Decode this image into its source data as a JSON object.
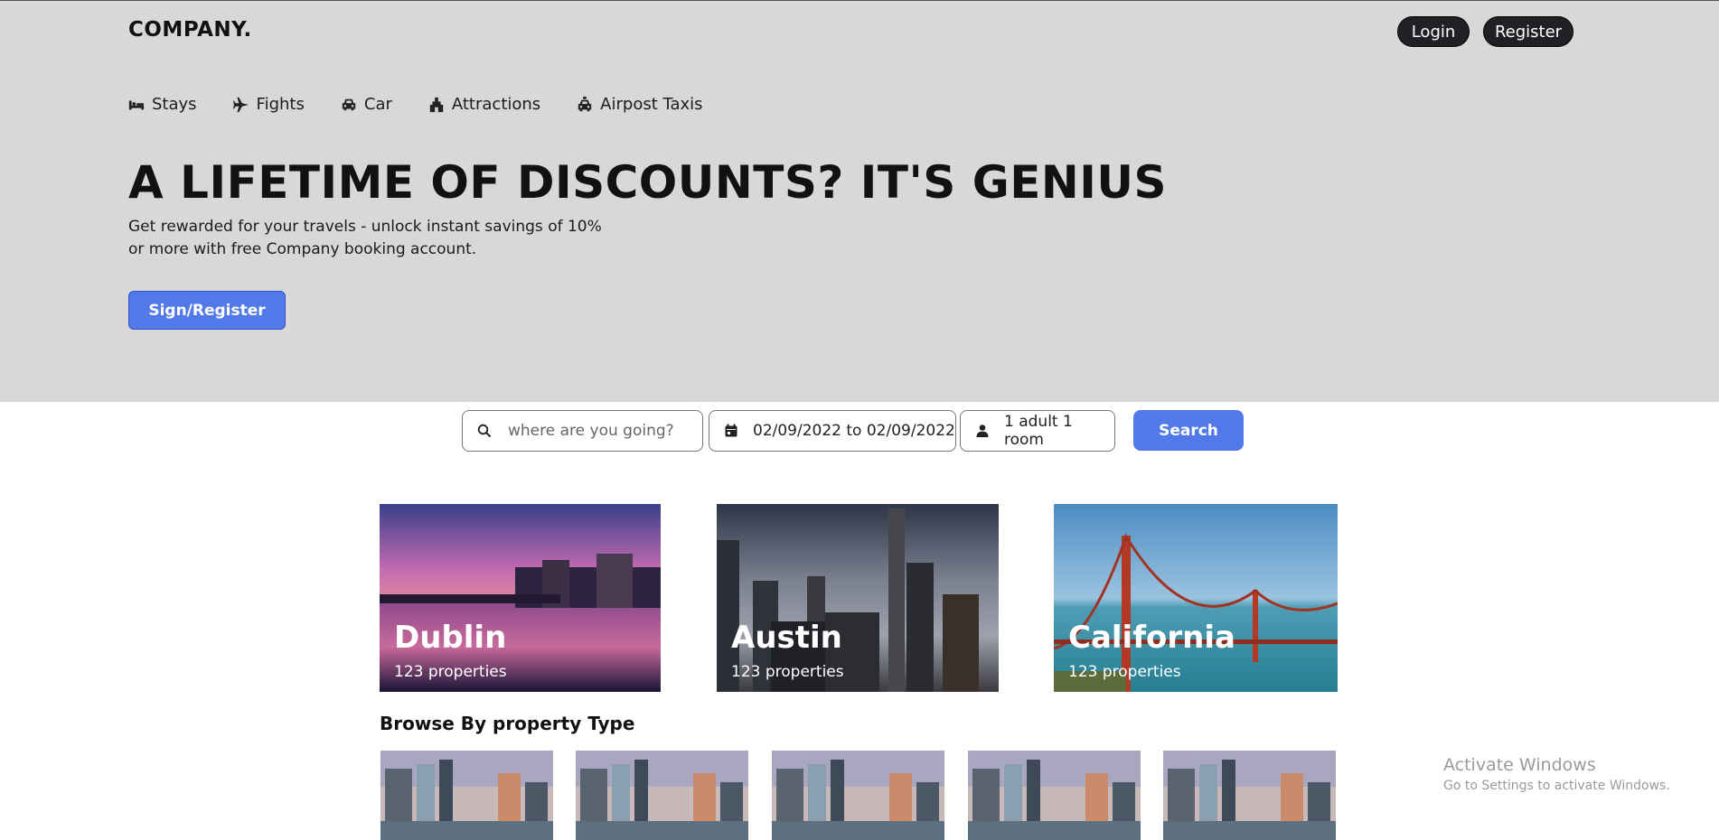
{
  "brand": "COMPANY.",
  "auth": {
    "login_label": "Login",
    "register_label": "Register"
  },
  "nav": [
    {
      "label": "Stays",
      "icon": "bed-icon"
    },
    {
      "label": "Fights",
      "icon": "plane-icon"
    },
    {
      "label": "Car",
      "icon": "car-icon"
    },
    {
      "label": "Attractions",
      "icon": "attraction-icon"
    },
    {
      "label": "Airpost Taxis",
      "icon": "taxi-icon"
    }
  ],
  "hero": {
    "headline": "A LIFETIME OF DISCOUNTS? IT'S GENIUS",
    "subtitle": "Get rewarded for your travels - unlock instant savings of 10% or more with free Company booking account.",
    "cta_label": "Sign/Register"
  },
  "search": {
    "destination_placeholder": "where are you going?",
    "date_range": "02/09/2022 to 02/09/2022",
    "guests": "1 adult 1 room",
    "button_label": "Search"
  },
  "cities": [
    {
      "name": "Dublin",
      "properties": "123 properties"
    },
    {
      "name": "Austin",
      "properties": "123 properties"
    },
    {
      "name": "California",
      "properties": "123 properties"
    }
  ],
  "browse_title": "Browse By property Type",
  "windows_watermark": {
    "title": "Activate Windows",
    "subtitle": "Go to Settings to activate Windows."
  },
  "colors": {
    "hero_bg": "#d9d8d7",
    "accent": "#5279e8",
    "dark_button": "#202124"
  }
}
